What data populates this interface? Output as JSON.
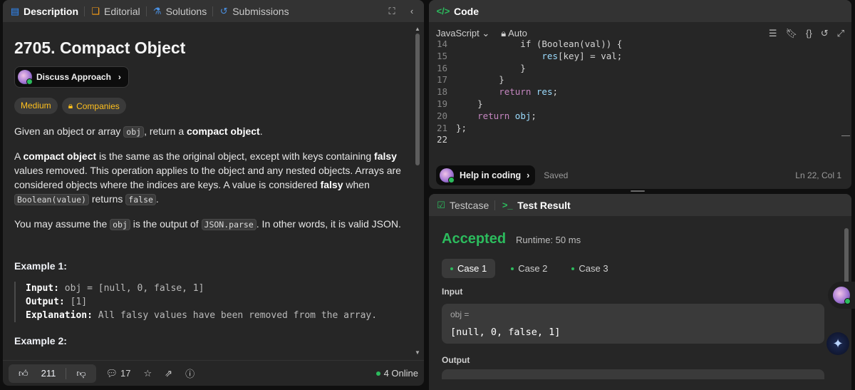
{
  "left_tabs": [
    {
      "label": "Description",
      "icon": "document-icon"
    },
    {
      "label": "Editorial",
      "icon": "book-icon"
    },
    {
      "label": "Solutions",
      "icon": "flask-icon"
    },
    {
      "label": "Submissions",
      "icon": "history-icon"
    }
  ],
  "problem": {
    "title": "2705. Compact Object",
    "discuss_label": "Discuss Approach",
    "difficulty": "Medium",
    "companies": "Companies",
    "p1_a": "Given an object or array ",
    "p1_code": "obj",
    "p1_b": ", return a ",
    "p1_bold": "compact object",
    "p1_c": ".",
    "p2_a": "A ",
    "p2_bold1": "compact object",
    "p2_b": " is the same as the original object, except with keys containing ",
    "p2_bold2": "falsy",
    "p2_c": " values removed. This operation applies to the object and any nested objects. Arrays are considered objects where the indices are keys. A value is considered ",
    "p2_bold3": "falsy",
    "p2_d": " when ",
    "p2_code1": "Boolean(value)",
    "p2_e": " returns ",
    "p2_code2": "false",
    "p2_f": ".",
    "p3_a": "You may assume the ",
    "p3_code1": "obj",
    "p3_b": " is the output of ",
    "p3_code2": "JSON.parse",
    "p3_c": ". In other words, it is valid JSON.",
    "example1_title": "Example 1:",
    "ex1_input_label": "Input:",
    "ex1_input": " obj = [null, 0, false, 1]",
    "ex1_output_label": "Output:",
    "ex1_output": " [1]",
    "ex1_expl_label": "Explanation:",
    "ex1_expl": " All falsy values have been removed from the array.",
    "example2_title": "Example 2:"
  },
  "footer": {
    "likes": "211",
    "comments": "17",
    "online": "4 Online"
  },
  "code_panel": {
    "title": "Code",
    "language": "JavaScript",
    "mode": "Auto",
    "lines": [
      {
        "n": "14",
        "html_parts": [
          [
            "tok",
            "            if (Boolean(val)) {"
          ]
        ]
      },
      {
        "n": "15",
        "html_parts": [
          [
            "var",
            "                res"
          ],
          [
            "tok",
            "[key] = val;"
          ]
        ]
      },
      {
        "n": "16",
        "html_parts": [
          [
            "tok",
            "            }"
          ]
        ]
      },
      {
        "n": "17",
        "html_parts": [
          [
            "tok",
            "        }"
          ]
        ]
      },
      {
        "n": "18",
        "html_parts": [
          [
            "kw",
            "        return "
          ],
          [
            "var",
            "res"
          ],
          [
            "tok",
            ";"
          ]
        ]
      },
      {
        "n": "19",
        "html_parts": [
          [
            "tok",
            "    }"
          ]
        ]
      },
      {
        "n": "20",
        "html_parts": [
          [
            "kw",
            "    return "
          ],
          [
            "var",
            "obj"
          ],
          [
            "tok",
            ";"
          ]
        ]
      },
      {
        "n": "21",
        "html_parts": [
          [
            "tok",
            "};"
          ]
        ]
      },
      {
        "n": "22",
        "html_parts": [
          [
            "tok",
            ""
          ]
        ]
      }
    ],
    "help_label": "Help in coding",
    "saved": "Saved",
    "cursor_pos": "Ln 22, Col 1"
  },
  "test_panel": {
    "tab_testcase": "Testcase",
    "tab_result": "Test Result",
    "status": "Accepted",
    "runtime": "Runtime: 50 ms",
    "cases": [
      "Case 1",
      "Case 2",
      "Case 3"
    ],
    "input_label": "Input",
    "input_name": "obj =",
    "input_value": "[null, 0, false, 1]",
    "output_label": "Output"
  }
}
